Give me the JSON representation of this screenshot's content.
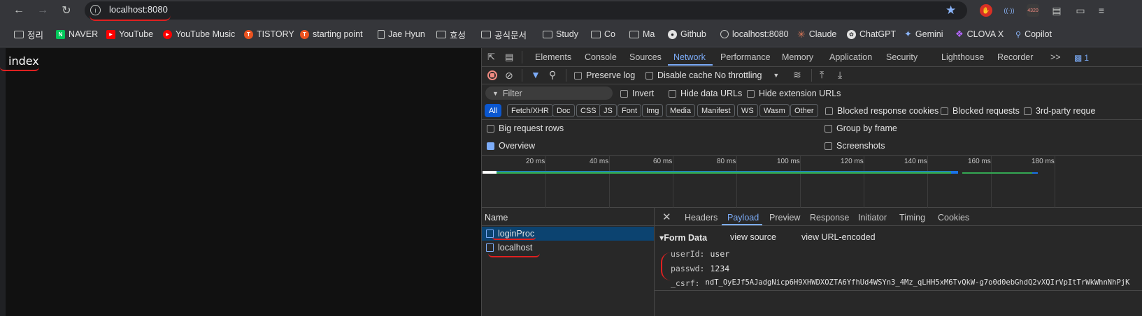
{
  "browser": {
    "url": "localhost:8080"
  },
  "bookmarks": [
    {
      "label": "정리",
      "icon": "folder-icon"
    },
    {
      "label": "NAVER",
      "icon": "naver-icon",
      "color": "#03c75a"
    },
    {
      "label": "YouTube",
      "icon": "youtube-icon",
      "color": "#ff0000"
    },
    {
      "label": "YouTube Music",
      "icon": "youtube-music-icon",
      "color": "#ff0000"
    },
    {
      "label": "TISTORY",
      "icon": "tistory-icon",
      "color": "#eb531f"
    },
    {
      "label": "starting point",
      "icon": "tistory-icon",
      "color": "#eb531f"
    },
    {
      "label": "Jae Hyun",
      "icon": "file-icon"
    },
    {
      "label": "효성",
      "icon": "folder-icon"
    },
    {
      "label": "공식문서",
      "icon": "folder-icon"
    },
    {
      "label": "Study",
      "icon": "folder-icon"
    },
    {
      "label": "Co",
      "icon": "folder-icon"
    },
    {
      "label": "Ma",
      "icon": "folder-icon"
    },
    {
      "label": "Github",
      "icon": "github-icon"
    },
    {
      "label": "localhost:8080",
      "icon": "globe-icon"
    },
    {
      "label": "Claude",
      "icon": "claude-icon",
      "color": "#d97757"
    },
    {
      "label": "ChatGPT",
      "icon": "chatgpt-icon"
    },
    {
      "label": "Gemini",
      "icon": "gemini-icon",
      "color": "#8ab4f8"
    },
    {
      "label": "CLOVA X",
      "icon": "clova-icon",
      "color": "#b366ff"
    },
    {
      "label": "Copilot",
      "icon": "search-icon"
    }
  ],
  "page": {
    "heading": "index"
  },
  "devtools": {
    "tabs": [
      "Elements",
      "Console",
      "Sources",
      "Network",
      "Performance",
      "Memory",
      "Application",
      "Security",
      "Lighthouse",
      "Recorder"
    ],
    "active_tab": "Network",
    "more_tabs": ">>",
    "issues_count": "1",
    "toolbar": {
      "preserve_log": "Preserve log",
      "disable_cache": "Disable cache",
      "throttling": "No throttling"
    },
    "filter": {
      "placeholder": "Filter",
      "invert": "Invert",
      "hide_data_urls": "Hide data URLs",
      "hide_extension_urls": "Hide extension URLs"
    },
    "type_filters": [
      "All",
      "Fetch/XHR",
      "Doc",
      "CSS",
      "JS",
      "Font",
      "Img",
      "Media",
      "Manifest",
      "WS",
      "Wasm",
      "Other"
    ],
    "active_type": "All",
    "blocked_response_cookies": "Blocked response cookies",
    "blocked_requests": "Blocked requests",
    "third_party_requests": "3rd-party reque",
    "options": {
      "big_request_rows": "Big request rows",
      "group_by_frame": "Group by frame",
      "overview": "Overview",
      "screenshots": "Screenshots"
    },
    "timeline_ticks": [
      "20 ms",
      "40 ms",
      "60 ms",
      "80 ms",
      "100 ms",
      "120 ms",
      "140 ms",
      "160 ms",
      "180 ms"
    ],
    "requests_header": "Name",
    "requests": [
      "loginProc",
      "localhost"
    ],
    "detail_tabs": [
      "Headers",
      "Payload",
      "Preview",
      "Response",
      "Initiator",
      "Timing",
      "Cookies"
    ],
    "active_detail_tab": "Payload",
    "form_data": {
      "title": "▾Form Data",
      "view_source": "view source",
      "view_url_encoded": "view URL-encoded",
      "fields": [
        {
          "key": "userId:",
          "value": "user"
        },
        {
          "key": "passwd:",
          "value": "1234"
        },
        {
          "key": "_csrf:",
          "value": "ndT_OyEJf5AJadgNicp6H9XHWDXOZTA6YfhUd4WSYn3_4Mz_qLHH5xM6TvQkW-g7o0d0ebGhdQ2vXQIrVpItTrWkWhnNhPjK"
        }
      ]
    }
  },
  "colors": {
    "accent": "#7cacf8",
    "annotation": "#e02020"
  }
}
